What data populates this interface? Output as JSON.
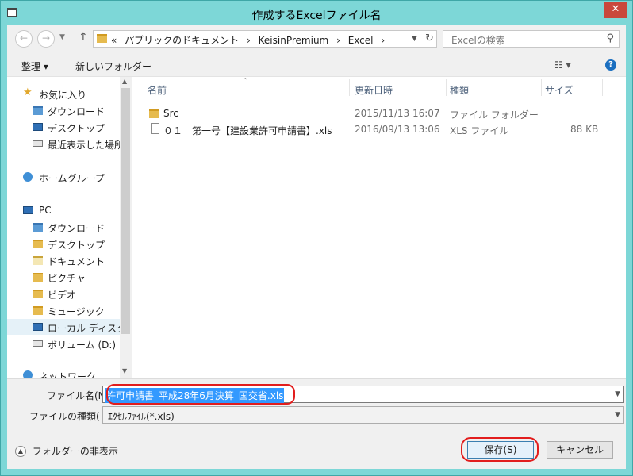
{
  "window": {
    "title": "作成するExcelファイル名",
    "close": "✕"
  },
  "nav": {
    "back": "←",
    "forward": "→",
    "up": "↑",
    "breadcrumbs": [
      "«",
      "パブリックのドキュメント",
      "›",
      "KeisinPremium",
      "›",
      "Excel",
      "›"
    ],
    "search_placeholder": "Excelの検索"
  },
  "toolbar": {
    "organize": "整理 ▾",
    "new_folder": "新しいフォルダー"
  },
  "sidebar": {
    "favorites": "お気に入り",
    "fav_items": [
      "ダウンロード",
      "デスクトップ",
      "最近表示した場所"
    ],
    "homegroup": "ホームグループ",
    "pc": "PC",
    "pc_items": [
      "ダウンロード",
      "デスクトップ",
      "ドキュメント",
      "ピクチャ",
      "ビデオ",
      "ミュージック",
      "ローカル ディスク (C",
      "ボリューム (D:)"
    ],
    "network": "ネットワーク"
  },
  "files": {
    "columns": [
      "名前",
      "更新日時",
      "種類",
      "サイズ"
    ],
    "rows": [
      {
        "name": "Src",
        "date": "2015/11/13 16:07",
        "type": "ファイル フォルダー",
        "size": ""
      },
      {
        "name": "０１　第一号【建設業許可申請書】.xls",
        "date": "2016/09/13 13:06",
        "type": "XLS ファイル",
        "size": "88 KB"
      }
    ]
  },
  "form": {
    "filename_label": "ファイル名(N):",
    "filename_value": "許可申請書_平成28年6月決算_国交省.xls",
    "filetype_label": "ファイルの種類(T):",
    "filetype_value": "ｴｸｾﾙﾌｧｲﾙ(*.xls)"
  },
  "footer": {
    "hide_folders": "フォルダーの非表示",
    "save": "保存(S)",
    "cancel": "キャンセル"
  },
  "colors": {
    "accent_oval": "#e21d1d",
    "selection": "#3399ff",
    "titlebar": "#7dd7d7"
  }
}
